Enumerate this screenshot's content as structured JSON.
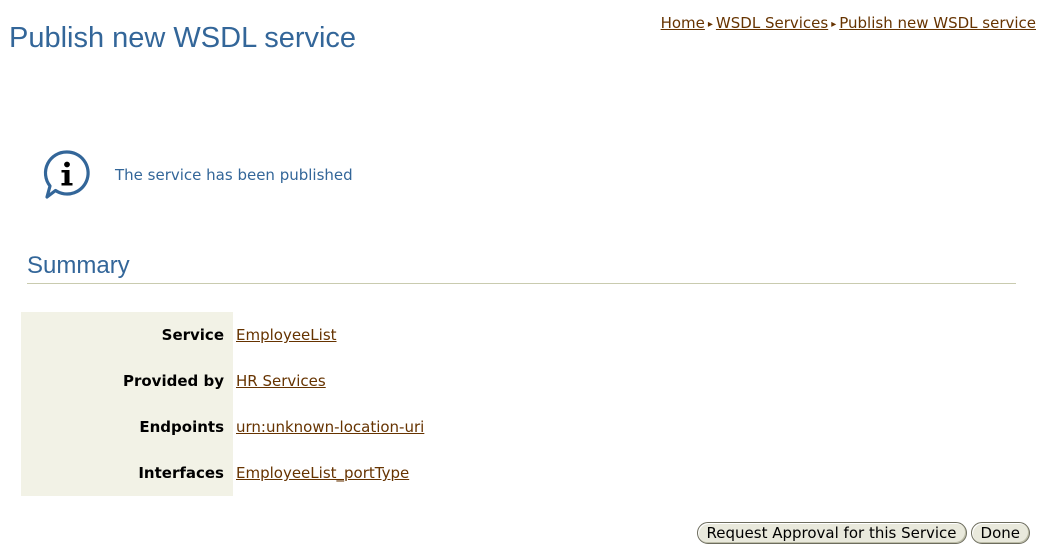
{
  "header": {
    "title": "Publish new WSDL service"
  },
  "breadcrumb": {
    "items": [
      "Home",
      "WSDL Services",
      "Publish new WSDL service"
    ],
    "separator": "▸"
  },
  "message": {
    "icon": "info-icon",
    "text": "The service has been published"
  },
  "summary": {
    "heading": "Summary",
    "rows": [
      {
        "label": "Service",
        "value": "EmployeeList"
      },
      {
        "label": "Provided by",
        "value": "HR Services"
      },
      {
        "label": "Endpoints",
        "value": "urn:unknown-location-uri"
      },
      {
        "label": "Interfaces",
        "value": "EmployeeList_portType"
      }
    ]
  },
  "buttons": {
    "request_approval": "Request Approval for this Service",
    "done": "Done"
  },
  "colors": {
    "title_blue": "#336699",
    "link_brown": "#663300",
    "label_background": "#f2f2e6"
  }
}
